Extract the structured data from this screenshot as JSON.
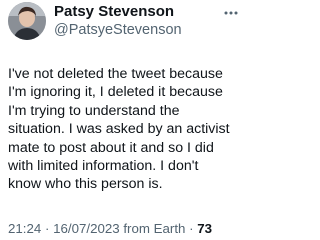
{
  "author": {
    "display_name": "Patsy Stevenson",
    "handle": "@PatsyeStevenson",
    "avatar_icon": "avatar"
  },
  "more_icon": "more-horizontal-icon",
  "tweet": {
    "lines": [
      "I've not deleted the tweet because",
      "I'm ignoring it, I deleted it because",
      "I'm trying to understand the",
      "situation. I was asked by an activist",
      "mate to post about it and so I did",
      "with limited information. I don't",
      "know who this person is."
    ]
  },
  "meta": {
    "time": "21:24",
    "separator": " · ",
    "date": "16/07/2023",
    "source": " from Earth",
    "separator2": " · ",
    "views": "73"
  }
}
